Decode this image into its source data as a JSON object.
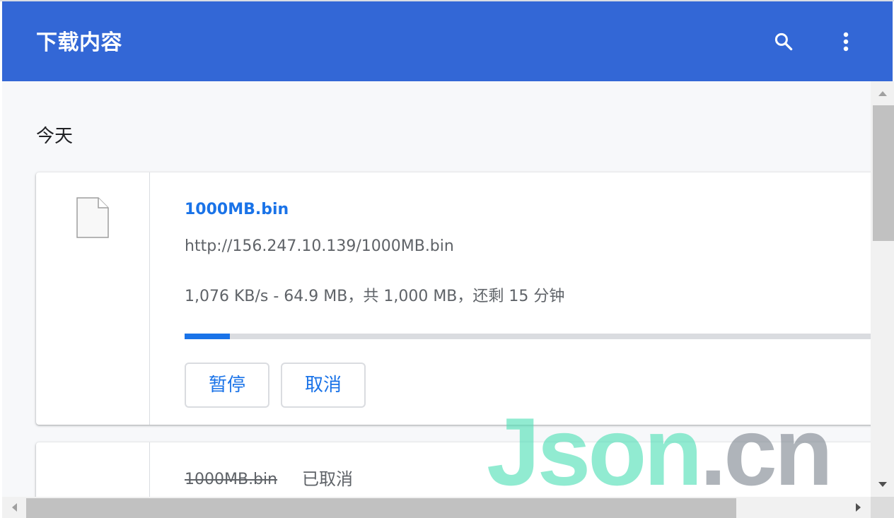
{
  "header": {
    "title": "下载内容",
    "search_icon": "search-icon",
    "menu_icon": "more-vert-icon",
    "color": "#3367d6"
  },
  "downloads": {
    "section_label": "今天",
    "items": [
      {
        "file_name": "1000MB.bin",
        "url": "http://156.247.10.139/1000MB.bin",
        "status": "1,076 KB/s - 64.9 MB，共 1,000 MB，还剩 15 分钟",
        "progress_fraction": 0.0649,
        "pause_label": "暂停",
        "cancel_label": "取消",
        "icon": "file-icon"
      },
      {
        "file_name": "1000MB.bin",
        "status": "已取消"
      }
    ]
  },
  "watermark": {
    "part_a": "Json",
    "part_b": ".cn"
  },
  "colors": {
    "link": "#1a73e8",
    "progress": "#1a73e8",
    "watermark_a": "#4fe0b6",
    "watermark_b": "#7f8790"
  }
}
